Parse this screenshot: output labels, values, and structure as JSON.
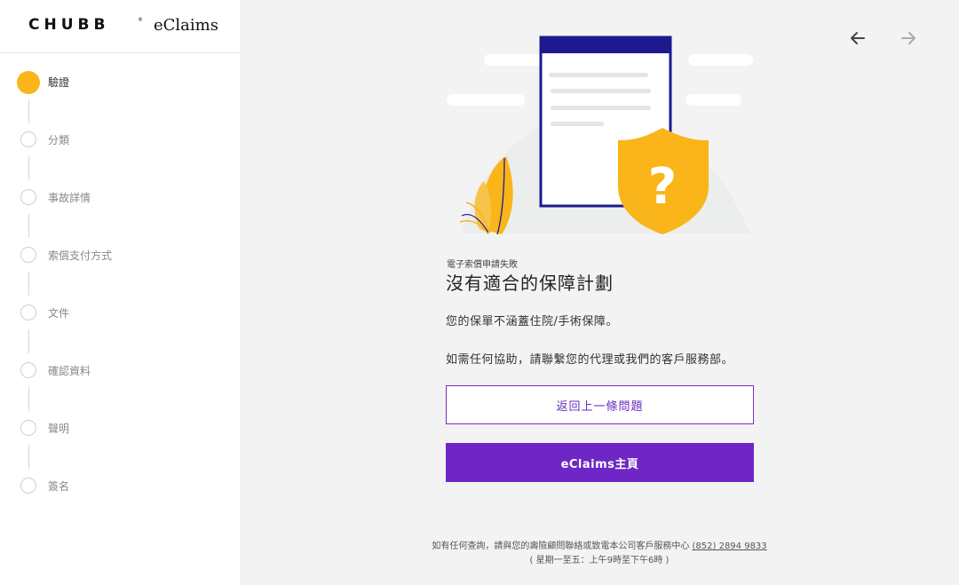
{
  "brand": {
    "name": "CHUBB",
    "registered": "®",
    "product": "eClaims"
  },
  "steps": [
    {
      "label": "驗證",
      "active": true
    },
    {
      "label": "分類",
      "active": false
    },
    {
      "label": "事故詳情",
      "active": false
    },
    {
      "label": "索償支付方式",
      "active": false
    },
    {
      "label": "文件",
      "active": false
    },
    {
      "label": "確認資料",
      "active": false
    },
    {
      "label": "聲明",
      "active": false
    },
    {
      "label": "簽名",
      "active": false
    }
  ],
  "content": {
    "subtitle": "電子索償申請失敗",
    "title": "沒有適合的保障計劃",
    "para1": "您的保單不涵蓋住院/手術保障。",
    "para2": "如需任何協助，請聯繫您的代理或我們的客戶服務部。",
    "back_button": "返回上一條問題",
    "home_button": "eClaims主頁"
  },
  "footer": {
    "line1": "如有任何查詢，請與您的壽險顧問聯絡或致電本公司客戶服務中心",
    "phone": "(852) 2894 9833",
    "line2": "( 星期一至五：上午9時至下午6時 )"
  },
  "colors": {
    "accent": "#f9b519",
    "primary": "#6e27c5",
    "navy": "#1d1a8f"
  },
  "icons": {
    "back": "arrow-left-icon",
    "forward": "arrow-right-icon"
  }
}
